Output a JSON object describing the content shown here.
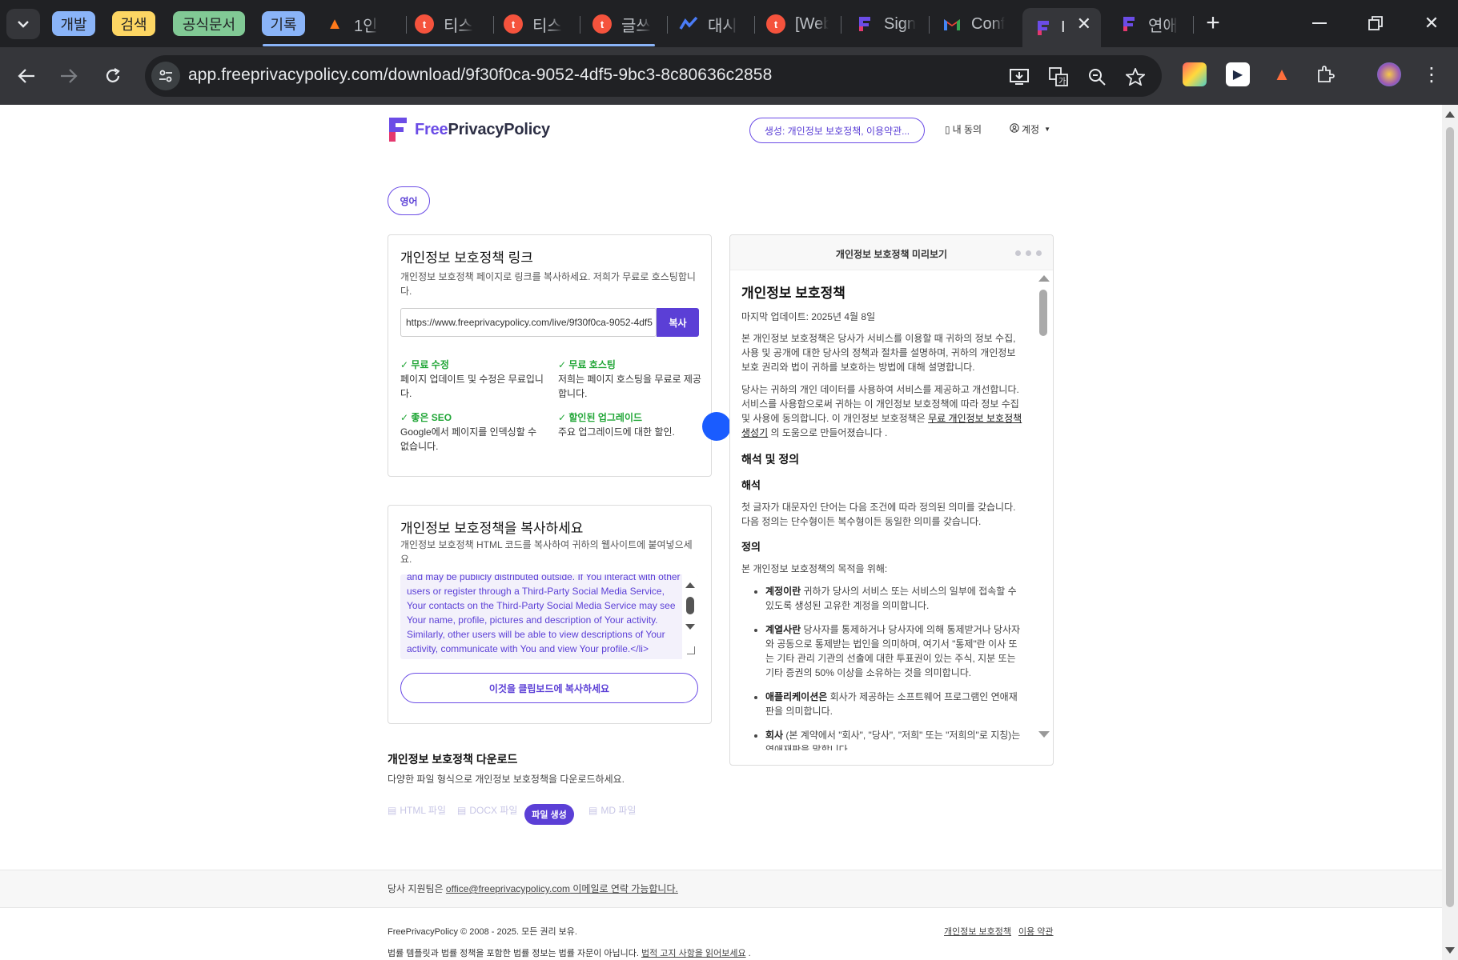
{
  "browser": {
    "tab_groups": [
      {
        "label": "개발",
        "color": "#8ab4f8"
      },
      {
        "label": "검색",
        "color": "#fdd663"
      },
      {
        "label": "공식문서",
        "color": "#81c995"
      },
      {
        "label": "기록",
        "color": "#8ab4f8"
      }
    ],
    "tabs": [
      {
        "title": "1인 ",
        "icon": "fire-icon"
      },
      {
        "title": "티스",
        "icon": "tistory-icon"
      },
      {
        "title": "티스",
        "icon": "tistory-icon"
      },
      {
        "title": "글쓰",
        "icon": "tistory-icon"
      },
      {
        "title": "대시",
        "icon": "chart-icon"
      },
      {
        "title": "[Web",
        "icon": "tistory-icon"
      },
      {
        "title": "Sign",
        "icon": "freeprivacypolicy-icon"
      },
      {
        "title": "Conf",
        "icon": "gmail-icon"
      },
      {
        "title": "I",
        "icon": "freeprivacypolicy-icon"
      },
      {
        "title": "연애",
        "icon": "freeprivacypolicy-icon"
      }
    ],
    "url": "app.freeprivacypolicy.com/download/9f30f0ca-9052-4df5-9bc3-8c80636c2858"
  },
  "header": {
    "brand_free": "Free",
    "brand_rest": "PrivacyPolicy",
    "generate_button": "생성: 개인정보 보호정책, 이용약관...",
    "my_consent": "내 동의",
    "account": "계정"
  },
  "language_pill": "영어",
  "link_card": {
    "title": "개인정보 보호정책 링크",
    "description": "개인정보 보호정책 페이지로 링크를 복사하세요. 저희가 무료로 호스팅합니다.",
    "link_value": "https://www.freeprivacypolicy.com/live/9f30f0ca-9052-4df5",
    "copy_button": "복사",
    "features": [
      {
        "title": "✓ 무료 수정",
        "desc": "페이지 업데이트 및 수정은 무료입니다."
      },
      {
        "title": "✓ 무료 호스팅",
        "desc": "저희는 페이지 호스팅을 무료로 제공합니다."
      },
      {
        "title": "✓ 좋은 SEO",
        "desc": "Google에서 페이지를 인덱싱할 수 없습니다."
      },
      {
        "title": "✓ 할인된 업그레이드",
        "desc": "주요 업그레이드에 대한 할인."
      }
    ]
  },
  "copy_card": {
    "title": "개인정보 보호정책을 복사하세요",
    "description": "개인정보 보호정책 HTML 코드를 복사하여 귀하의 웹사이트에 붙여넣으세요.",
    "code": "and may be publicly distributed outside. If You interact with other users or register through a Third-Party Social Media Service, Your contacts on the Third-Party Social Media Service may see Your name, profile, pictures and description of Your activity. Similarly, other users will be able to view descriptions of Your activity, communicate with You and view Your profile.</li>",
    "copy_clipboard_button": "이것을 클립보드에 복사하세요"
  },
  "preview": {
    "header": "개인정보 보호정책 미리보기",
    "title": "개인정보 보호정책",
    "updated": "마지막 업데이트: 2025년 4월 8일",
    "p1": "본 개인정보 보호정책은 당사가 서비스를 이용할 때 귀하의 정보 수집, 사용 및 공개에 대한 당사의 정책과 절차를 설명하며, 귀하의 개인정보 보호 권리와 법이 귀하를 보호하는 방법에 대해 설명합니다.",
    "p2_a": "당사는 귀하의 개인 데이터를 사용하여 서비스를 제공하고 개선합니다. 서비스를 사용함으로써 귀하는 이 개인정보 보호정책에 따라 정보 수집 및 사용에 동의합니다. 이 개인정보 보호정책은 ",
    "p2_link": "무료 개인정보 보호정책 생성기",
    "p2_b": " 의 도움으로 만들어졌습니다 .",
    "h_interp_def": "해석 및 정의",
    "h_interp": "해석",
    "p_interp": "첫 글자가 대문자인 단어는 다음 조건에 따라 정의된 의미를 갖습니다. 다음 정의는 단수형이든 복수형이든 동일한 의미를 갖습니다.",
    "h_def": "정의",
    "p_def": "본 개인정보 보호정책의 목적을 위해:",
    "defs": [
      {
        "term": "계정이란",
        "text": " 귀하가 당사의 서비스 또는 서비스의 일부에 접속할 수 있도록 생성된 고유한 계정을 의미합니다."
      },
      {
        "term": "계열사란",
        "text": " 당사자를 통제하거나 당사자에 의해 통제받거나 당사자와 공동으로 통제받는 법인을 의미하며, 여기서 \"통제\"란 이사 또는 기타 관리 기관의 선출에 대한 투표권이 있는 주식, 지분 또는 기타 증권의 50% 이상을 소유하는 것을 의미합니다."
      },
      {
        "term": "애플리케이션은",
        "text": " 회사가 제공하는 소프트웨어 프로그램인 연애재판을 의미합니다."
      },
      {
        "term": "회사",
        "text": " (본 계약에서 \"회사\", \"당사\", \"저희\" 또는 \"저희의\"로 지칭)는 연애재판을 말합니다."
      }
    ]
  },
  "download": {
    "title": "개인정보 보호정책 다운로드",
    "description": "다양한 파일 형식으로 개인정보 보호정책을 다운로드하세요.",
    "options": [
      "HTML 파일",
      "DOCX 파일",
      "",
      "MD 파일"
    ],
    "generate_pill": "파일 생성"
  },
  "footer": {
    "support_prefix": "당사 지원팀은 ",
    "support_email": "office@freeprivacypolicy.com",
    "support_suffix": " 이메일로 연락 가능합니다.",
    "copyright": "FreePrivacyPolicy © 2008 - 2025. 모든 권리 보유.",
    "link_privacy": "개인정보 보호정책",
    "link_terms": "이용 약관",
    "disclaimer_prefix": "법률 템플릿과 법률 정책을 포함한 법률 정보는 법률 자문이 아닙니다. ",
    "disclaimer_link": "법적 고지 사항을 읽어보세요",
    "disclaimer_suffix": " ."
  },
  "colors": {
    "accent": "#5b3fd6",
    "success": "#21a637",
    "cursor": "#1a5cff"
  }
}
